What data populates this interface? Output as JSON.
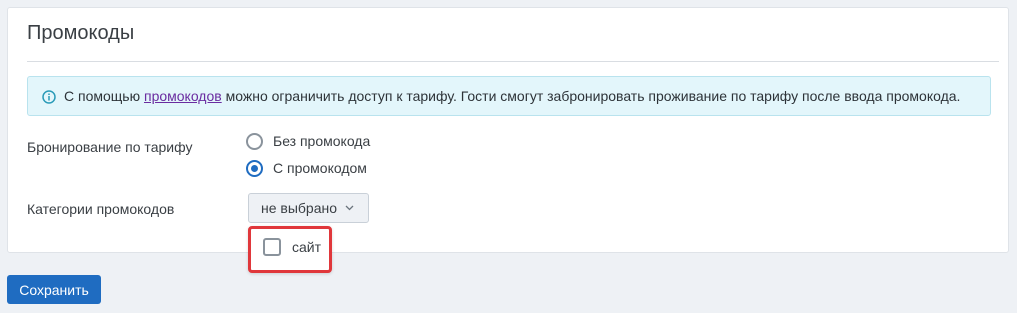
{
  "panel": {
    "title": "Промокоды"
  },
  "info": {
    "icon": "info-icon",
    "text_before": "С помощью ",
    "link": "промокодов",
    "text_after": " можно ограничить доступ к тарифу. Гости смогут забронировать проживание по тарифу после ввода промокода."
  },
  "booking": {
    "label": "Бронирование по тарифу",
    "options": [
      {
        "label": "Без промокода",
        "checked": false
      },
      {
        "label": "С промокодом",
        "checked": true
      }
    ]
  },
  "categories": {
    "label": "Категории промокодов",
    "dropdown_value": "не выбрано",
    "dropdown_icon": "chevron-down-icon",
    "items": [
      {
        "label": "сайт",
        "checked": false
      }
    ]
  },
  "actions": {
    "save_label": "Сохранить"
  },
  "colors": {
    "accent": "#1f6cc1",
    "highlight": "#e0373b",
    "info_bg": "#e3f6fb",
    "link": "#6a2ca0"
  }
}
